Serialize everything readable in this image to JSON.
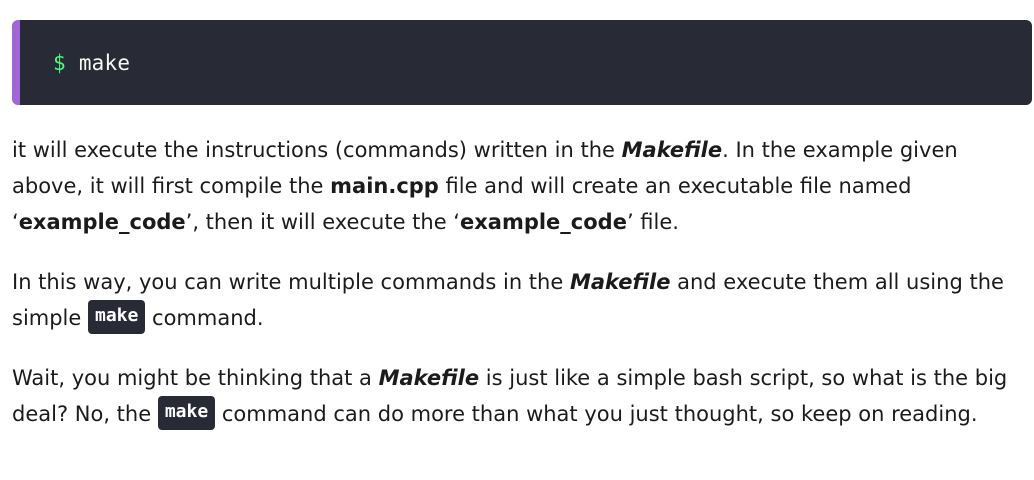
{
  "code_block": {
    "prompt": "$",
    "command": "make"
  },
  "paragraphs": {
    "p1": {
      "t1": "it will execute the instructions (commands) written in the ",
      "makefile": "Makefile",
      "t2": ". In the example given above, it will first compile the ",
      "main_cpp": "main.cpp",
      "t3": " file and will create an executable file named ‘",
      "example_code_1": "example_code",
      "t4": "’, then it will execute the ‘",
      "example_code_2": "example_code",
      "t5": "’ file."
    },
    "p2": {
      "t1": "In this way, you can write multiple commands in the ",
      "makefile": "Makefile",
      "t2": " and execute them all using the simple ",
      "code": "make",
      "t3": " command."
    },
    "p3": {
      "t1": "Wait, you might be thinking that a ",
      "makefile": "Makefile",
      "t2": " is just like a simple bash script, so what is the big deal? No, the ",
      "code": "make",
      "t3": " command can do more than what you just thought, so keep on reading."
    }
  }
}
